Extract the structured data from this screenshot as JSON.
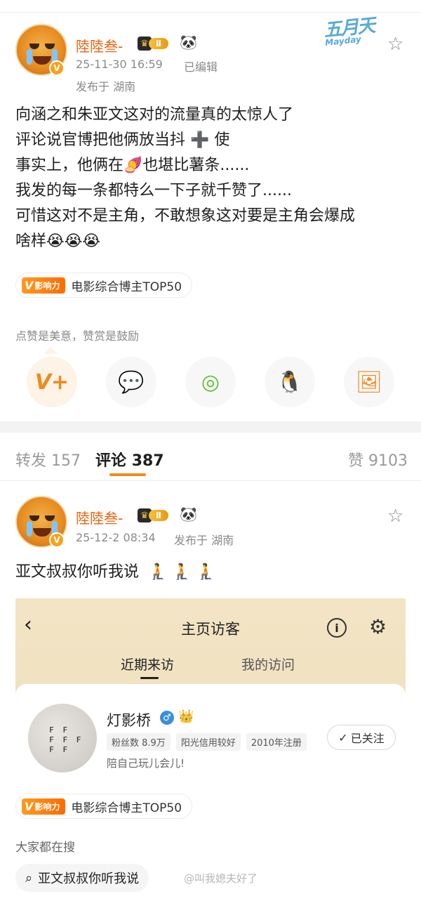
{
  "post": {
    "username": "陸陸叁-",
    "level_badge": "Ⅱ",
    "timestamp": "25-11-30 16:59",
    "edited_label": "已编辑",
    "location": "发布于 湖南",
    "text_lines": [
      "向涵之和朱亚文这对的流量真的太惊人了",
      "评论说官博把他俩放当抖 ➕ 使",
      "事实上，他俩在🍠也堪比薯条......",
      "我发的每一条都特么一下子就千赞了......",
      "可惜这对不是主角，不敢想象这对要是主角会爆成",
      "啥样😭😭😭"
    ],
    "influence_label": "影响力",
    "influence_text": "电影综合博主TOP50",
    "like_hint": "点赞是美意，赞赏是鼓励",
    "watermark_logo": "五月天"
  },
  "tabs": {
    "repost_label": "转发",
    "repost_count": "157",
    "comment_label": "评论",
    "comment_count": "387",
    "like_label": "赞",
    "like_count": "9103"
  },
  "comment": {
    "username": "陸陸叁-",
    "level_badge": "Ⅱ",
    "timestamp": "25-12-2 08:34",
    "location": "发布于 湖南",
    "text": "亚文叔叔你听我说",
    "emoji_suffix": "🧎 🧎 🧎",
    "screenshot": {
      "title": "主页访客",
      "tab_recent": "近期来访",
      "tab_mine": "我的访问",
      "visitor_name": "灯影桥",
      "tags": [
        "粉丝数 8.9万",
        "阳光信用较好",
        "2010年注册"
      ],
      "bio": "陪自己玩儿会儿!",
      "follow_label": "已关注"
    },
    "influence_label": "影响力",
    "influence_text": "电影综合博主TOP50",
    "search_heading": "大家都在搜",
    "search_chip": "亚文叔叔你听我说",
    "watermark": "@叫我媳夫好了"
  },
  "colors": {
    "accent_orange": "#e6620e",
    "tab_underline": "#f08a1c"
  }
}
